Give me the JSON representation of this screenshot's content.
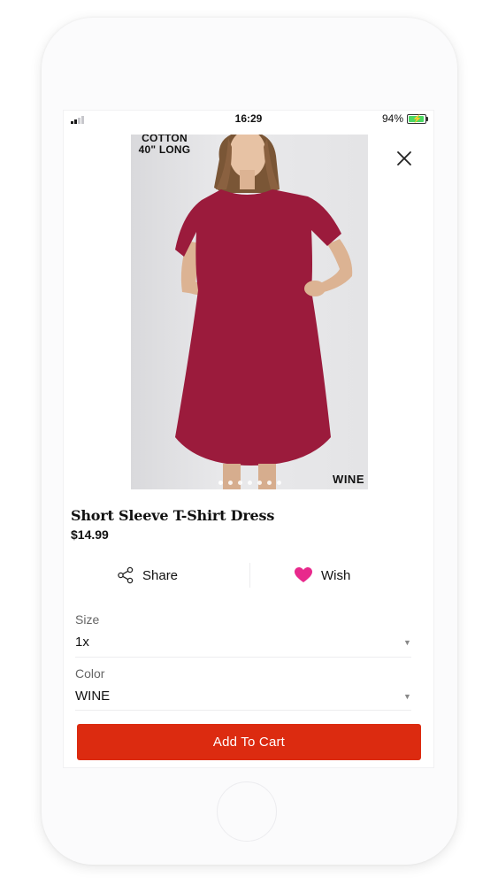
{
  "status": {
    "time": "16:29",
    "battery_pct": "94%",
    "battery_level": 0.94,
    "battery_color": "#4cd964"
  },
  "product": {
    "image_tag_line1": "COTTON",
    "image_tag_line2": "40\" LONG",
    "image_color_label": "WINE",
    "image_count": 7,
    "current_image": 1,
    "title": "Short Sleeve T-Shirt Dress",
    "price": "$14.99",
    "dress_color": "#9b1b3c"
  },
  "actions": {
    "share_label": "Share",
    "wish_label": "Wish",
    "wish_color": "#e8298c"
  },
  "options": {
    "size_label": "Size",
    "size_value": "1x",
    "color_label": "Color",
    "color_value": "WINE"
  },
  "cart": {
    "label": "Add To Cart",
    "color": "#dc2b10"
  },
  "icons": {
    "close": "close-icon",
    "share": "share-icon",
    "wish": "heart-icon",
    "dropdown": "caret-down-icon"
  }
}
